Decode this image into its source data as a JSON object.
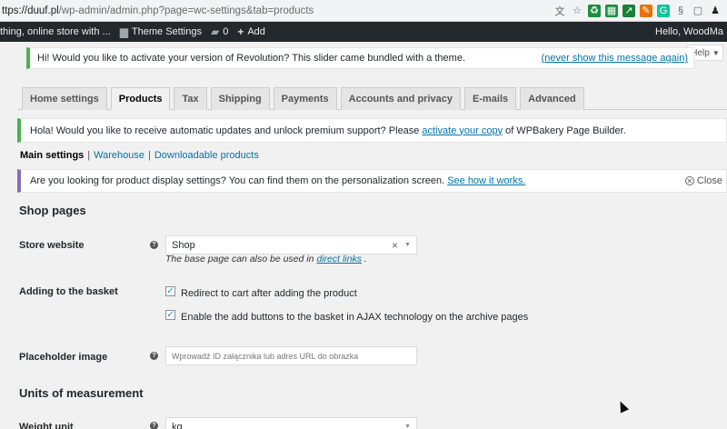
{
  "browser": {
    "url_host": "ttps://duuf.pl",
    "url_rest": "/wp-admin/admin.php?page=wc-settings&tab=products",
    "extensions": [
      {
        "icon": "translate-icon",
        "glyph": "文",
        "color": "#5f6368"
      },
      {
        "icon": "star-icon",
        "glyph": "☆",
        "color": "#5f6368"
      },
      {
        "icon": "recycle-icon",
        "glyph": "♻",
        "color": "#1e8e3e"
      },
      {
        "icon": "apps-icon",
        "glyph": "▦",
        "color": "#1e8e3e"
      },
      {
        "icon": "graph-icon",
        "glyph": "↗",
        "color": "#188038"
      },
      {
        "icon": "paint-icon",
        "glyph": "✎",
        "color": "#e8710a"
      },
      {
        "icon": "grammarly-icon",
        "glyph": "G",
        "color": "#15c39a"
      },
      {
        "icon": "section-icon",
        "glyph": "§",
        "color": "#5f6368"
      },
      {
        "icon": "window-icon",
        "glyph": "▢",
        "color": "#5f6368"
      },
      {
        "icon": "profile-icon",
        "glyph": "♟",
        "color": "#202124"
      }
    ]
  },
  "adminbar": {
    "site_name": "thing, online store with ...",
    "theme_settings": "Theme Settings",
    "comments_count": "0",
    "add_new": "Add",
    "greeting": "Hello, WoodMa"
  },
  "help": {
    "label": "Help"
  },
  "notices": {
    "revolution": {
      "text": "Hi! Would you like to activate your version of Revolution? This slider came bundled with a theme.",
      "dismiss": "(never show this message again)"
    },
    "wpbakery": {
      "text_before": "Hola! Would you like to receive automatic updates and unlock premium support? Please",
      "link": "activate your copy",
      "text_after": "of WPBakery Page Builder."
    },
    "product_display": {
      "text": "Are you looking for product display settings? You can find them on the personalization screen.",
      "link": "See how it works.",
      "close": "Close"
    }
  },
  "tabs": [
    {
      "label": "Home settings",
      "active": false
    },
    {
      "label": "Products",
      "active": true
    },
    {
      "label": "Tax",
      "active": false
    },
    {
      "label": "Shipping",
      "active": false
    },
    {
      "label": "Payments",
      "active": false
    },
    {
      "label": "Accounts and privacy",
      "active": false
    },
    {
      "label": "E-mails",
      "active": false
    },
    {
      "label": "Advanced",
      "active": false
    }
  ],
  "subsections": {
    "current": "Main settings",
    "sep": "|",
    "links": [
      "Warehouse",
      "Downloadable products"
    ]
  },
  "shop_pages": {
    "heading": "Shop pages",
    "store_website": {
      "label": "Store website",
      "value": "Shop",
      "desc_before": "The base page can also be used in",
      "desc_link": "direct links",
      "desc_after": "."
    },
    "adding_to_basket": {
      "label": "Adding to the basket",
      "options": [
        {
          "label": "Redirect to cart after adding the product",
          "checked": true
        },
        {
          "label": "Enable the add buttons to the basket in AJAX technology on the archive pages",
          "checked": true
        }
      ]
    },
    "placeholder_image": {
      "label": "Placeholder image",
      "placeholder": "Wprowadź ID załącznika lub adres URL do obrazka"
    }
  },
  "units": {
    "heading": "Units of measurement",
    "weight_unit": {
      "label": "Weight unit",
      "value": "kg"
    }
  }
}
